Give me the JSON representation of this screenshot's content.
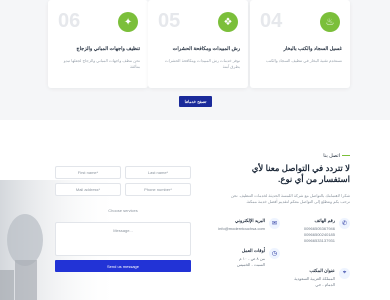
{
  "cards": [
    {
      "number": "06",
      "title": "تنظيف واجهات المباني والزجاج",
      "desc": "نحن ننظف واجهات المباني والزجاج لجعلها تبدو متألقة",
      "icon": "sparkle-cleaning-icon"
    },
    {
      "number": "05",
      "title": "رش المبيدات ومكافحة الحشرات",
      "desc": "نوفر خدمات رش المبيدات ومكافحة الحشرات بطرق آمنة",
      "icon": "spray-icon"
    },
    {
      "number": "04",
      "title": "غسيل السجاد والكنب بالبخار",
      "desc": "نستخدم تقنية البخار في تنظيف السجاد والكنب",
      "icon": "steam-icon"
    }
  ],
  "more_button": "تصفح خدماتنا",
  "contact": {
    "subheading": "اتصل بنا",
    "heading": "لا تتردد في التواصل معنا لأي استفسار من أي نوع.",
    "paragraph": "شكرا لاهتمامك بالتواصل مع شركة اللمسة الحديثة لخدمات التنظيف. نحن نرحب بكم ونتطلع إلى التواصل معكم لتقديم أفضل خدمة ممكنة.",
    "phone": {
      "title": "رقم الهاتف",
      "lines": [
        "00966505367946",
        "00966500240185",
        "00966533137931"
      ],
      "icon": "phone-icon"
    },
    "email": {
      "title": "البريد الإلكتروني",
      "lines": [
        "info@moderntouchsa.com"
      ],
      "icon": "mail-icon"
    },
    "address": {
      "title": "عنوان المكتب",
      "lines": [
        "المملكة العربية السعودية",
        "الدمام - حي"
      ],
      "icon": "location-icon"
    },
    "hours": {
      "title": "أوقات العمل",
      "lines": [
        "من ٨ ص - ١٠ م",
        "السبت - الخميس"
      ],
      "icon": "clock-icon"
    }
  },
  "form": {
    "last_name": "Last name*",
    "first_name": "First name*",
    "phone": "Phone number*",
    "email": "Mail address*",
    "service": "Choose services",
    "message": "Message...",
    "send": "Send us message"
  }
}
